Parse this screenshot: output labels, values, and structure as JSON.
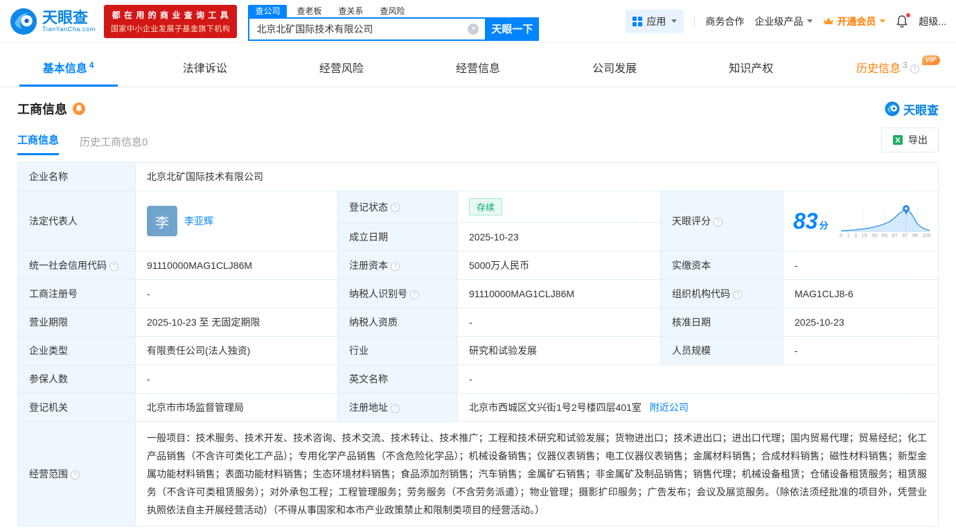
{
  "brand": {
    "name": "天眼查",
    "domain": "TianYanCha.com",
    "promo_line1": "都 在 用 的 商 业 查 询 工 具",
    "promo_line2": "国家中小企业发展子基金旗下机构"
  },
  "search": {
    "tabs": [
      {
        "label": "查公司"
      },
      {
        "label": "查老板"
      },
      {
        "label": "查关系"
      },
      {
        "label": "查风险"
      }
    ],
    "value": "北京北矿国际技术有限公司",
    "button_label": "天眼一下"
  },
  "nav": {
    "apps": "应用",
    "cooperation": "商务合作",
    "enterprise_products": "企业级产品",
    "vip": "开通会员",
    "user": "超级..."
  },
  "main_tabs": [
    {
      "label": "基本信息",
      "count": "4"
    },
    {
      "label": "法律诉讼"
    },
    {
      "label": "经营风险"
    },
    {
      "label": "经营信息"
    },
    {
      "label": "公司发展"
    },
    {
      "label": "知识产权"
    },
    {
      "label": "历史信息",
      "count": "3",
      "badge": "VIP"
    }
  ],
  "section": {
    "title": "工商信息",
    "watermark": "天眼查",
    "subtabs": [
      {
        "label": "工商信息"
      },
      {
        "label": "历史工商信息0"
      }
    ],
    "export_label": "导出"
  },
  "info": {
    "company_name": {
      "label": "企业名称",
      "value": "北京北矿国际技术有限公司"
    },
    "legal_rep": {
      "label": "法定代表人",
      "avatar_char": "李",
      "name": "李亚辉"
    },
    "reg_status": {
      "label": "登记状态",
      "value": "存续"
    },
    "score": {
      "label": "天眼评分",
      "value": "83",
      "unit": "分"
    },
    "est_date": {
      "label": "成立日期",
      "value": "2025-10-23"
    },
    "credit_code": {
      "label": "统一社会信用代码",
      "value": "91110000MAG1CLJ86M"
    },
    "reg_capital": {
      "label": "注册资本",
      "value": "5000万人民币"
    },
    "paid_capital": {
      "label": "实缴资本",
      "value": "-"
    },
    "reg_no": {
      "label": "工商注册号",
      "value": "-"
    },
    "taxpayer_id": {
      "label": "纳税人识别号",
      "value": "91110000MAG1CLJ86M"
    },
    "org_code": {
      "label": "组织机构代码",
      "value": "MAG1CLJ8-6"
    },
    "business_term": {
      "label": "营业期限",
      "value": "2025-10-23 至 无固定期限"
    },
    "taxpayer_quality": {
      "label": "纳税人资质",
      "value": "-"
    },
    "approved_date": {
      "label": "核准日期",
      "value": "2025-10-23"
    },
    "company_type": {
      "label": "企业类型",
      "value": "有限责任公司(法人独资)"
    },
    "industry": {
      "label": "行业",
      "value": "研究和试验发展"
    },
    "staff_size": {
      "label": "人员规模",
      "value": "-"
    },
    "insured_num": {
      "label": "参保人数",
      "value": "-"
    },
    "english_name": {
      "label": "英文名称",
      "value": "-"
    },
    "reg_authority": {
      "label": "登记机关",
      "value": "北京市市场监督管理局"
    },
    "reg_address": {
      "label": "注册地址",
      "value": "北京市西城区文兴街1号2号楼四层401室",
      "nearby_link": "附近公司"
    },
    "business_scope": {
      "label": "经营范围",
      "value": "一般项目：技术服务、技术开发、技术咨询、技术交流、技术转让、技术推广；工程和技术研究和试验发展；货物进出口；技术进出口；进出口代理；国内贸易代理；贸易经纪；化工产品销售（不含许可类化工产品）；专用化学产品销售（不含危险化学品）；机械设备销售；仪器仪表销售；电工仪器仪表销售；金属材料销售；合成材料销售；磁性材料销售；新型金属功能材料销售；表面功能材料销售；生态环境材料销售；食品添加剂销售；汽车销售；金属矿石销售；非金属矿及制品销售；销售代理；机械设备租赁；仓储设备租赁服务；租赁服务（不含许可类租赁服务）；对外承包工程；工程管理服务；劳务服务（不含劳务派遣）；物业管理；摄影扩印服务；广告发布；会议及展览服务。（除依法须经批准的项目外，凭营业执照依法自主开展经营活动）（不得从事国家和本市产业政策禁止和限制类项目的经营活动。）"
    }
  },
  "score_chart": {
    "type": "area",
    "score": 83,
    "ticks": [
      "0",
      "1",
      "3",
      "15",
      "50",
      "83",
      "87",
      "97",
      "99",
      "100"
    ]
  },
  "colors": {
    "brand_blue": "#0084ff",
    "vip_orange": "#ff7d00",
    "promo_red": "#d21717",
    "status_green": "#00a870",
    "label_cell_bg": "#eef7fe"
  }
}
